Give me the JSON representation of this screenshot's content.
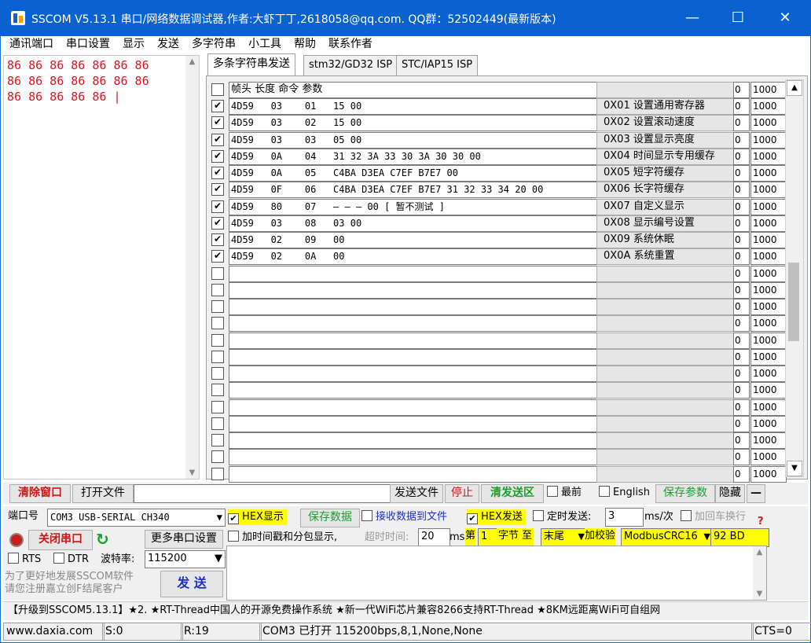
{
  "window": {
    "title": "SSCOM V5.13.1 串口/网络数据调试器,作者:大虾丁丁,2618058@qq.com. QQ群：52502449(最新版本)",
    "min": "—",
    "max": "☐",
    "close": "✕"
  },
  "menu": [
    "通讯端口",
    "串口设置",
    "显示",
    "发送",
    "多字符串",
    "小工具",
    "帮助",
    "联系作者"
  ],
  "receive": {
    "text": "86 86 86 86 86 86 86\n86 86 86 86 86 86 86\n86 86 86 86 86 |"
  },
  "tabs": [
    "多条字符串发送",
    "stm32/GD32 ISP",
    "STC/IAP15 ISP"
  ],
  "table": {
    "header": "帧头 长度 命令 参数",
    "rows": [
      {
        "checked": true,
        "cmd": "4D59   03    01   15 00",
        "button": "0X01 设置通用寄存器",
        "a": "0",
        "b": "1000"
      },
      {
        "checked": true,
        "cmd": "4D59   03    02   15 00",
        "button": "0X02 设置滚动速度",
        "a": "0",
        "b": "1000"
      },
      {
        "checked": true,
        "cmd": "4D59   03    03   05 00",
        "button": "0X03 设置显示亮度",
        "a": "0",
        "b": "1000"
      },
      {
        "checked": true,
        "cmd": "4D59   0A    04   31 32 3A 33 30 3A 30 30 00",
        "button": "0X04 时间显示专用缓存",
        "a": "0",
        "b": "1000"
      },
      {
        "checked": true,
        "cmd": "4D59   0A    05   C4BA D3EA C7EF B7E7 00",
        "button": "0X05 短字符缓存",
        "a": "0",
        "b": "1000"
      },
      {
        "checked": true,
        "cmd": "4D59   0F    06   C4BA D3EA C7EF B7E7 31 32 33 34 20 00",
        "button": "0X06 长字符缓存",
        "a": "0",
        "b": "1000"
      },
      {
        "checked": true,
        "cmd": "4D59   80    07   — — — 00 [ 暂不测试 ]",
        "button": "0X07 自定义显示",
        "a": "0",
        "b": "1000"
      },
      {
        "checked": true,
        "cmd": "4D59   03    08   03 00",
        "button": "0X08 显示编号设置",
        "a": "0",
        "b": "1000"
      },
      {
        "checked": true,
        "cmd": "4D59   02    09   00",
        "button": "0X09 系统休眠",
        "a": "0",
        "b": "1000"
      },
      {
        "checked": true,
        "cmd": "4D59   02    0A   00",
        "button": "0X0A 系统重置",
        "a": "0",
        "b": "1000"
      },
      {
        "checked": false,
        "cmd": "",
        "button": "",
        "a": "0",
        "b": "1000"
      },
      {
        "checked": false,
        "cmd": "",
        "button": "",
        "a": "0",
        "b": "1000"
      },
      {
        "checked": false,
        "cmd": "",
        "button": "",
        "a": "0",
        "b": "1000"
      },
      {
        "checked": false,
        "cmd": "",
        "button": "",
        "a": "0",
        "b": "1000"
      },
      {
        "checked": false,
        "cmd": "",
        "button": "",
        "a": "0",
        "b": "1000"
      },
      {
        "checked": false,
        "cmd": "",
        "button": "",
        "a": "0",
        "b": "1000"
      },
      {
        "checked": false,
        "cmd": "",
        "button": "",
        "a": "0",
        "b": "1000"
      },
      {
        "checked": false,
        "cmd": "",
        "button": "",
        "a": "0",
        "b": "1000"
      },
      {
        "checked": false,
        "cmd": "",
        "button": "",
        "a": "0",
        "b": "1000"
      },
      {
        "checked": false,
        "cmd": "",
        "button": "",
        "a": "0",
        "b": "1000"
      },
      {
        "checked": false,
        "cmd": "",
        "button": "",
        "a": "0",
        "b": "1000"
      },
      {
        "checked": false,
        "cmd": "",
        "button": "",
        "a": "0",
        "b": "1000"
      },
      {
        "checked": false,
        "cmd": "",
        "button": "",
        "a": "0",
        "b": "1000"
      },
      {
        "checked": false,
        "cmd": "",
        "button": "",
        "a": "0",
        "b": "1000"
      }
    ]
  },
  "toolbar": {
    "clear_window": "清除窗口",
    "open_file": "打开文件",
    "file_path": "",
    "send_file": "发送文件",
    "stop": "停止",
    "clear_send": "清发送区",
    "topmost": "最前",
    "english": "English",
    "save_params": "保存参数",
    "hide": "隐藏",
    "collapse": "—"
  },
  "lower": {
    "port_label": "端口号",
    "port_value": "COM3 USB-SERIAL CH340",
    "close_port": "关闭串口",
    "more_settings": "更多串口设置",
    "rts": "RTS",
    "dtr": "DTR",
    "baud_label": "波特率:",
    "baud_value": "115200",
    "promo": "为了更好地发展SSCOM软件\n请您注册嘉立创F结尾客户",
    "send_btn": "发  送",
    "hex_display": "HEX显示",
    "save_data": "保存数据",
    "recv_to_file": "接收数据到文件",
    "hex_send": "HEX发送",
    "timed_send": "定时发送:",
    "timed_value": "3",
    "timed_unit": "ms/次",
    "add_crlf": "加回车换行",
    "timestamp": "加时间戳和分包显示,",
    "timeout_label": "超时时间:",
    "timeout_value": "20",
    "ms": "ms",
    "nth": "第",
    "byte_value": "1",
    "byte_to": "字节 至",
    "end_value": "末尾",
    "checksum_label": "加校验",
    "checksum_value": "ModbusCRC16",
    "checksum_result": "92 BD"
  },
  "ad_line": "【升级到SSCOM5.13.1】★2. ★RT-Thread中国人的开源免费操作系统 ★新一代WiFi芯片兼容8266支持RT-Thread ★8KM远距离WiFi可自组网",
  "status": {
    "site": "www.daxia.com",
    "sent": "S:0",
    "recv": "R:19",
    "port_state": "COM3 已打开  115200bps,8,1,None,None",
    "cts": "CTS=0"
  }
}
